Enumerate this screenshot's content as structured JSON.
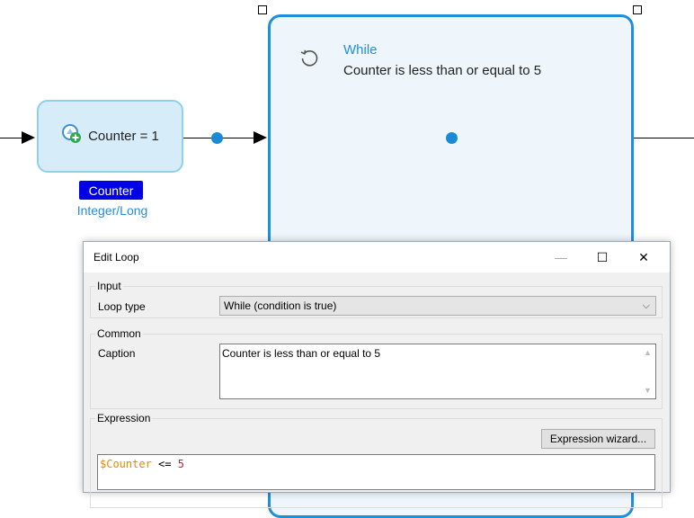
{
  "canvas": {
    "activity": {
      "label": "Counter = 1",
      "icon": "create-variable-icon"
    },
    "variable": {
      "name": "Counter",
      "type": "Integer/Long"
    },
    "loop": {
      "title": "While",
      "caption": "Counter is less than or equal to 5",
      "icon": "loop-icon"
    },
    "colors": {
      "accent": "#1e8fd9",
      "activity_fill": "#d6edf9",
      "variable_badge": "#0000e6"
    }
  },
  "dialog": {
    "title": "Edit Loop",
    "window_buttons": {
      "minimize": "—",
      "maximize": "☐",
      "close": "✕"
    },
    "input": {
      "legend": "Input",
      "loop_type_label": "Loop type",
      "loop_type_value": "While (condition is true)"
    },
    "common": {
      "legend": "Common",
      "caption_label": "Caption",
      "caption_value": "Counter is less than or equal to 5"
    },
    "expression": {
      "legend": "Expression",
      "wizard_button": "Expression wizard...",
      "code": {
        "variable": "$Counter",
        "operator": "<=",
        "number": "5"
      }
    }
  }
}
